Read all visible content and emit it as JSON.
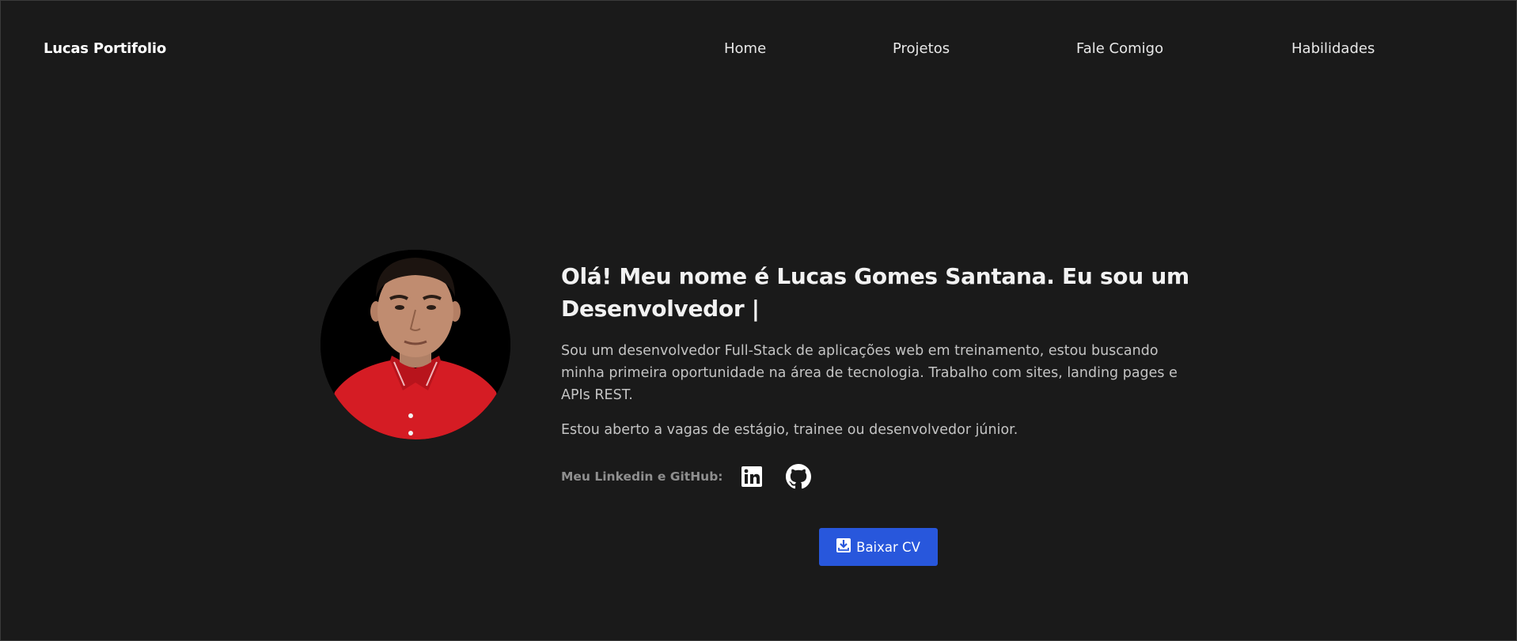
{
  "header": {
    "brand": "Lucas Portifolio",
    "nav": [
      {
        "label": "Home"
      },
      {
        "label": "Projetos"
      },
      {
        "label": "Fale Comigo"
      },
      {
        "label": "Habilidades"
      }
    ]
  },
  "hero": {
    "title": "Olá! Meu nome é Lucas Gomes Santana. Eu sou um Desenvolvedor |",
    "intro": "Sou um desenvolvedor Full-Stack de aplicações web em treinamento, estou buscando minha primeira oportunidade na área de tecnologia. Trabalho com sites, landing pages e APIs REST.",
    "availability": "Estou aberto a vagas de estágio, trainee ou desenvolvedor júnior.",
    "social_label": "Meu Linkedin e GitHub:",
    "social_icons": [
      "linkedin-icon",
      "github-icon"
    ],
    "cv_button": "Baixar CV",
    "cv_icon": "download-icon"
  },
  "colors": {
    "background": "#1a1a1a",
    "text": "#e6e6e6",
    "muted": "#8f8f8f",
    "accent": "#2857dc"
  }
}
